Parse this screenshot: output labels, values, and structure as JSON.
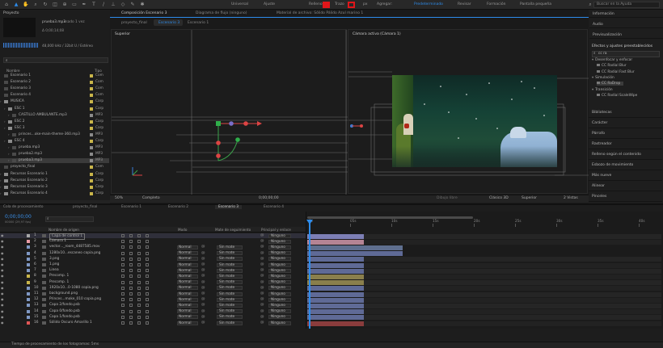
{
  "toolbar": {
    "universal": "Universal",
    "ajuste": "Ajuste",
    "relleno": "Relleno",
    "trazo": "Trazo",
    "px": "px",
    "agregar": "Agregar:",
    "workspaces": [
      "Predeterminado",
      "Revisar",
      "Formación",
      "Pantalla pequeña"
    ],
    "search_placeholder": "Buscar en la Ayuda",
    "fill_color": "#e0161a"
  },
  "project": {
    "title": "Proyecto",
    "file_name": "prueba3.mp3",
    "used": ", usado 1 vez",
    "duration": "Δ 0;00;14;08",
    "audio_info": "48,000 kHz / 32bit U / Estéreo",
    "col_name": "Nombre",
    "col_type": "Tipo",
    "items": [
      {
        "name": "Escenario 1",
        "type": "Com",
        "indent": 0,
        "kind": "comp",
        "color": "#c9b54a"
      },
      {
        "name": "Escenario 2",
        "type": "Com",
        "indent": 0,
        "kind": "comp",
        "color": "#c9b54a"
      },
      {
        "name": "Escenario 3",
        "type": "Com",
        "indent": 0,
        "kind": "comp",
        "color": "#c9b54a"
      },
      {
        "name": "Escenario 4",
        "type": "Com",
        "indent": 0,
        "kind": "comp",
        "color": "#c9b54a"
      },
      {
        "name": "MUSICA",
        "type": "Carp",
        "indent": 0,
        "kind": "folder",
        "color": "#c9b54a"
      },
      {
        "name": "ESC 1",
        "type": "Carp",
        "indent": 1,
        "kind": "folder",
        "color": "#c9b54a"
      },
      {
        "name": "CASTILLO AMBULANTE.mp3",
        "type": "MP3",
        "indent": 2,
        "kind": "file",
        "color": "#8b8b8b"
      },
      {
        "name": "ESC 2",
        "type": "Carp",
        "indent": 1,
        "kind": "folder",
        "color": "#c9b54a"
      },
      {
        "name": "ESC 3",
        "type": "Carp",
        "indent": 1,
        "kind": "folder",
        "color": "#c9b54a"
      },
      {
        "name": "princes...oke-main-theme-360.mp3",
        "type": "MP3",
        "indent": 2,
        "kind": "file",
        "color": "#8b8b8b"
      },
      {
        "name": "ESC 4",
        "type": "Carp",
        "indent": 1,
        "kind": "folder",
        "color": "#c9b54a"
      },
      {
        "name": "prueba.mp3",
        "type": "MP3",
        "indent": 2,
        "kind": "file",
        "color": "#8b8b8b"
      },
      {
        "name": "prueba2.mp3",
        "type": "MP3",
        "indent": 2,
        "kind": "file",
        "color": "#8b8b8b"
      },
      {
        "name": "prueba3.mp3",
        "type": "MP3",
        "indent": 2,
        "kind": "file",
        "color": "#8b8b8b",
        "selected": true
      },
      {
        "name": "proyecto_final",
        "type": "Com",
        "indent": 0,
        "kind": "comp",
        "color": "#c9b54a"
      },
      {
        "name": "Recursos Escenario 1",
        "type": "Carp",
        "indent": 0,
        "kind": "folder",
        "color": "#c9b54a"
      },
      {
        "name": "Recursos Escenario 2",
        "type": "Carp",
        "indent": 0,
        "kind": "folder",
        "color": "#c9b54a"
      },
      {
        "name": "Recursos Escenario 3",
        "type": "Carp",
        "indent": 0,
        "kind": "folder",
        "color": "#c9b54a"
      },
      {
        "name": "Recursos Escenario 4",
        "type": "Carp",
        "indent": 0,
        "kind": "folder",
        "color": "#c9b54a"
      }
    ]
  },
  "comp_panel": {
    "tab": "Composición Escenario 3",
    "flow_tab": "Diagrama de flujo (ninguno)",
    "material_tab": "Material de archivo: Sólido Pálido Azul marino 1",
    "subtabs": [
      "proyecto_final",
      "Escenario 3",
      "Escenario 1"
    ],
    "left_view": "Superior",
    "right_view": "Cámara activa (Cámara 1)",
    "zoom": "50%",
    "resolution": "Completo",
    "timecode": "0;00;00;00",
    "camera_label": "Dibujo libre",
    "renderer": "Clásico 3D",
    "view_select": "Superior",
    "views": "2 Vistas"
  },
  "right_panels": {
    "top": [
      "Información",
      "Audio",
      "Previsualización"
    ],
    "effects_title": "Efectos y ajustes preestablecidos",
    "effects_search": "cc ra",
    "effects_tree": [
      {
        "label": "Desenfocar y enfocar",
        "level": 0
      },
      {
        "label": "CC Radial Blur",
        "level": 1
      },
      {
        "label": "CC Radial Fast Blur",
        "level": 1
      },
      {
        "label": "Simulación",
        "level": 0
      },
      {
        "label": "CC RaDrop",
        "level": 1,
        "selected": true
      },
      {
        "label": "Transición",
        "level": 0
      },
      {
        "label": "CC Radial ScaleWipe",
        "level": 1
      }
    ],
    "bottom": [
      "Bibliotecas",
      "Carácter",
      "Párrafo",
      "Rastreador",
      "Relleno según el contenido",
      "Esbozo de movimiento",
      "Más nueve",
      "Alinear",
      "Pinceles"
    ]
  },
  "timeline": {
    "tabs": [
      "Cola de procesamiento",
      "proyecto_final",
      "Escenario 1",
      "Escenario 2",
      "Escenario 3",
      "Escenario 4"
    ],
    "active_tab": 4,
    "timecode": "0;00;00;00",
    "fps": "00000 (29,97 fps)",
    "col_name": "Nombre de origen",
    "col_mode": "Modo",
    "col_matte": "Mate de seguimiento",
    "col_parent": "Principal y enlace",
    "ruler": [
      "0s",
      "05s",
      "10s",
      "15s",
      "20s",
      "25s",
      "30s",
      "35s",
      "40s"
    ],
    "layers": [
      {
        "num": "1",
        "name": "Capa de control 1",
        "color": "#a8a8a8",
        "mode": "",
        "matte": "",
        "parent": "Ninguno",
        "bar": "#7d7fb5"
      },
      {
        "num": "2",
        "name": "Cámara 1",
        "color": "#ea9ca6",
        "mode": "",
        "matte": "",
        "parent": "Ninguno",
        "bar": "#b58494"
      },
      {
        "num": "3",
        "name": "vector..._room_4487585.mov",
        "color": "#7f98c4",
        "mode": "Normal",
        "matte": "Sin mate",
        "parent": "Ninguno",
        "bar": "#5f6f8f"
      },
      {
        "num": "4",
        "name": "1280x10...escaneo copia.png",
        "color": "#7f98c4",
        "mode": "Normal",
        "matte": "Sin mate",
        "parent": "Ninguno",
        "bar": "#5f6a96"
      },
      {
        "num": "5",
        "name": "3.png",
        "color": "#7f98c4",
        "mode": "Normal",
        "matte": "Sin mate",
        "parent": "Ninguno",
        "bar": "#5f6a96"
      },
      {
        "num": "6",
        "name": "1.png",
        "color": "#7f98c4",
        "mode": "Normal",
        "matte": "Sin mate",
        "parent": "Ninguno",
        "bar": "#5f6a96"
      },
      {
        "num": "7",
        "name": "Linea",
        "color": "#7f98c4",
        "mode": "Normal",
        "matte": "Sin mate",
        "parent": "Ninguno",
        "bar": "#5f6a96"
      },
      {
        "num": "8",
        "name": "Precomp. 1",
        "color": "#c9b54a",
        "mode": "Normal",
        "matte": "Sin mate",
        "parent": "Ninguno",
        "bar": "#8a7f4c"
      },
      {
        "num": "9",
        "name": "Precomp. 1",
        "color": "#c9b54a",
        "mode": "Normal",
        "matte": "Sin mate",
        "parent": "Ninguno",
        "bar": "#8a7f4c"
      },
      {
        "num": "10",
        "name": "1920x10...0-1080 copia.png",
        "color": "#7f98c4",
        "mode": "Normal",
        "matte": "Sin mate",
        "parent": "Ninguno",
        "bar": "#5f6a96"
      },
      {
        "num": "11",
        "name": "background.png",
        "color": "#7f98c4",
        "mode": "Normal",
        "matte": "Sin mate",
        "parent": "Ninguno",
        "bar": "#5f6a96"
      },
      {
        "num": "12",
        "name": "Princes...moke_010 copia.png",
        "color": "#7f98c4",
        "mode": "Normal",
        "matte": "Sin mate",
        "parent": "Ninguno",
        "bar": "#5f6a96"
      },
      {
        "num": "13",
        "name": "Capa 2/fondo.psb",
        "color": "#7f98c4",
        "mode": "Normal",
        "matte": "Sin mate",
        "parent": "Ninguno",
        "bar": "#5f6a96"
      },
      {
        "num": "14",
        "name": "Capa 0/fondo.psb",
        "color": "#7f98c4",
        "mode": "Normal",
        "matte": "Sin mate",
        "parent": "Ninguno",
        "bar": "#5f6a96"
      },
      {
        "num": "15",
        "name": "Capa 1/fondo.psb",
        "color": "#7f98c4",
        "mode": "Normal",
        "matte": "Sin mate",
        "parent": "Ninguno",
        "bar": "#5f6a96"
      },
      {
        "num": "16",
        "name": "Sólido Oscuro Amarillo 1",
        "color": "#e05656",
        "mode": "Normal",
        "matte": "Sin mate",
        "parent": "Ninguno",
        "bar": "#8a3c3c"
      }
    ],
    "status": "Tiempo de procesamiento de los fotogramas: 5ms"
  }
}
